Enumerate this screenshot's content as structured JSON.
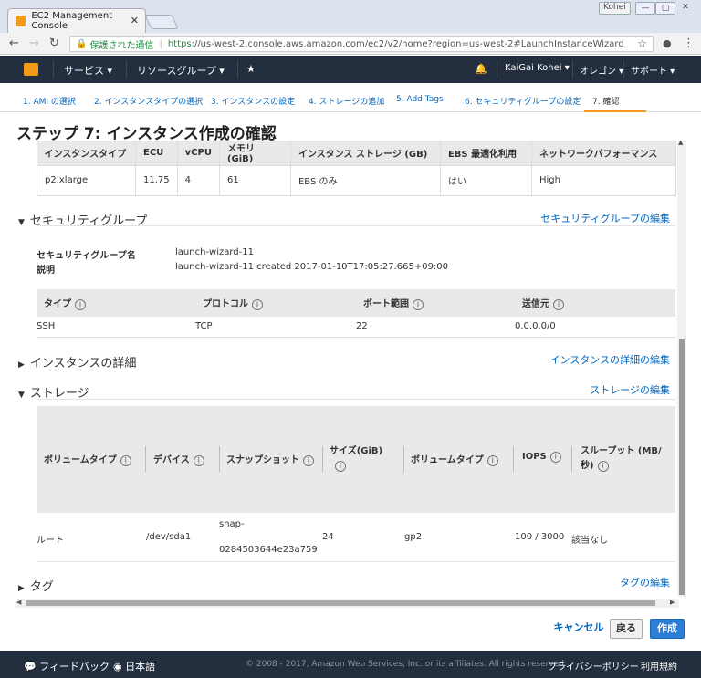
{
  "browser": {
    "tab_title": "EC2 Management Console",
    "user": "Kohei",
    "secure_label": "保護された通信",
    "url_proto": "https",
    "url_rest": "://us-west-2.console.aws.amazon.com/ec2/v2/home?region=us-west-2#LaunchInstanceWizard"
  },
  "awsnav": {
    "services": "サービス",
    "resource_groups": "リソースグループ",
    "user": "KaiGai Kohei",
    "region": "オレゴン",
    "support": "サポート"
  },
  "steps": [
    {
      "label": "1. AMI の選択"
    },
    {
      "label": "2. インスタンスタイプの選択"
    },
    {
      "label": "3. インスタンスの設定"
    },
    {
      "label": "4. ストレージの追加"
    },
    {
      "label": "5. Add Tags"
    },
    {
      "label": "6. セキュリティグループの設定"
    },
    {
      "label": "7. 確認"
    }
  ],
  "page_title": "ステップ 7: インスタンス作成の確認",
  "instance_table": {
    "headers": [
      "インスタンスタイプ",
      "ECU",
      "vCPU",
      "メモリ (GiB)",
      "インスタンス ストレージ (GB)",
      "EBS 最適化利用",
      "ネットワークパフォーマンス"
    ],
    "row": [
      "p2.xlarge",
      "11.75",
      "4",
      "61",
      "EBS のみ",
      "はい",
      "High"
    ]
  },
  "security": {
    "title": "セキュリティグループ",
    "edit_link": "セキュリティグループの編集",
    "name_label": "セキュリティグループ名",
    "name_value": "launch-wizard-11",
    "desc_label": "説明",
    "desc_value": "launch-wizard-11 created 2017-01-10T17:05:27.665+09:00",
    "headers": [
      "タイプ",
      "プロトコル",
      "ポート範囲",
      "送信元"
    ],
    "row": [
      "SSH",
      "TCP",
      "22",
      "0.0.0.0/0"
    ]
  },
  "instance_details": {
    "title": "インスタンスの詳細",
    "edit_link": "インスタンスの詳細の編集"
  },
  "storage": {
    "title": "ストレージ",
    "edit_link": "ストレージの編集",
    "headers": [
      "ボリュームタイプ",
      "デバイス",
      "スナップショット",
      "サイズ(GiB)",
      "ボリュームタイプ",
      "IOPS",
      "スループット (MB/秒)"
    ],
    "row": {
      "type": "ルート",
      "device": "/dev/sda1",
      "snap1": "snap-",
      "snap2": "0284503644e23a759",
      "size": "24",
      "voltype": "gp2",
      "iops": "100 / 3000",
      "throughput": "該当なし"
    }
  },
  "tags": {
    "title": "タグ",
    "edit_link": "タグの編集"
  },
  "actions": {
    "cancel": "キャンセル",
    "back": "戻る",
    "create": "作成"
  },
  "footer": {
    "feedback": "フィードバック",
    "language": "日本語",
    "copyright": "© 2008 - 2017, Amazon Web Services, Inc. or its affiliates. All rights reserved.",
    "privacy": "プライバシーポリシー",
    "terms": "利用規約"
  }
}
